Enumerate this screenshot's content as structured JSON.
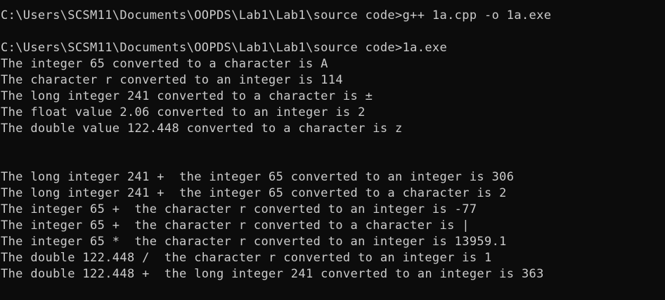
{
  "terminal": {
    "background": "#0c0c0c",
    "foreground": "#cccccc",
    "lines": [
      "C:\\Users\\SCSM11\\Documents\\OOPDS\\Lab1\\Lab1\\source code>g++ 1a.cpp -o 1a.exe",
      "C:\\Users\\SCSM11\\Documents\\OOPDS\\Lab1\\Lab1\\source code>1a.exe",
      "The integer 65 converted to a character is A",
      "The character r converted to an integer is 114",
      "The long integer 241 converted to a character is ±",
      "The float value 2.06 converted to an integer is 2",
      "The double value 122.448 converted to a character is z",
      "The long integer 241 +  the integer 65 converted to an integer is 306",
      "The long integer 241 +  the integer 65 converted to a character is 2",
      "The integer 65 +  the character r converted to an integer is -77",
      "The integer 65 +  the character r converted to a character is |",
      "The integer 65 *  the character r converted to an integer is 13959.1",
      "The double 122.448 /  the character r converted to an integer is 1",
      "The double 122.448 +  the long integer 241 converted to an integer is 363"
    ]
  }
}
